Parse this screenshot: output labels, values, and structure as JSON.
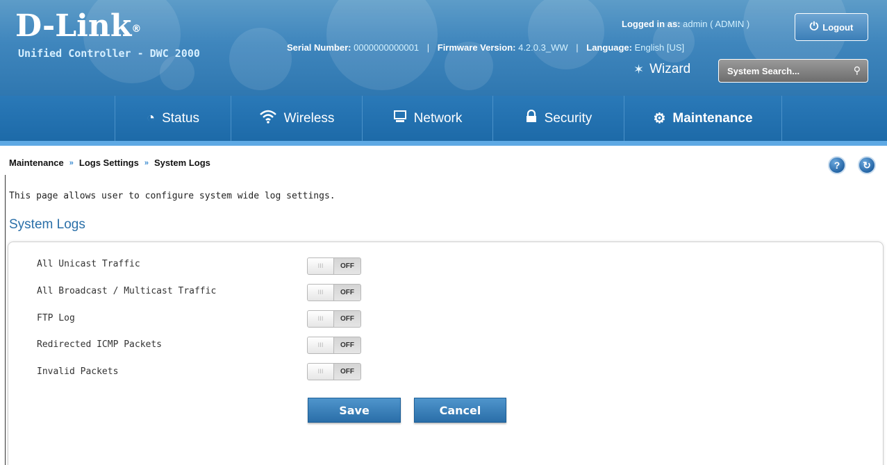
{
  "header": {
    "logo": "D-Link",
    "logo_reg": "®",
    "product": "Unified Controller - DWC 2000",
    "logged_in_label": "Logged in as:",
    "logged_in_value": "admin ( ADMIN )",
    "logout_label": "Logout",
    "serial_label": "Serial Number:",
    "serial_value": "0000000000001",
    "firmware_label": "Firmware Version:",
    "firmware_value": "4.2.0.3_WW",
    "language_label": "Language:",
    "language_value": "English [US]",
    "wizard_label": "Wizard",
    "search_placeholder": "System Search..."
  },
  "nav": {
    "items": [
      {
        "label": "Status",
        "icon": "gauge-icon"
      },
      {
        "label": "Wireless",
        "icon": "wifi-icon"
      },
      {
        "label": "Network",
        "icon": "monitor-icon"
      },
      {
        "label": "Security",
        "icon": "lock-icon"
      },
      {
        "label": "Maintenance",
        "icon": "gears-icon"
      }
    ],
    "active": "Maintenance"
  },
  "breadcrumb": [
    "Maintenance",
    "Logs Settings",
    "System Logs"
  ],
  "breadcrumb_sep": "»",
  "page": {
    "description": "This page allows user to configure system wide log settings.",
    "section_title": "System Logs"
  },
  "settings": [
    {
      "label": "All Unicast Traffic",
      "state": "OFF"
    },
    {
      "label": "All Broadcast / Multicast Traffic",
      "state": "OFF"
    },
    {
      "label": "FTP Log",
      "state": "OFF"
    },
    {
      "label": "Redirected ICMP Packets",
      "state": "OFF"
    },
    {
      "label": "Invalid Packets",
      "state": "OFF"
    }
  ],
  "toggle_grip": "III",
  "buttons": {
    "save": "Save",
    "cancel": "Cancel"
  },
  "colors": {
    "header_blue": "#3f86bd",
    "nav_blue": "#1d6aa8",
    "accent_light": "#5ea9e4",
    "section_title": "#2a6fa8"
  }
}
